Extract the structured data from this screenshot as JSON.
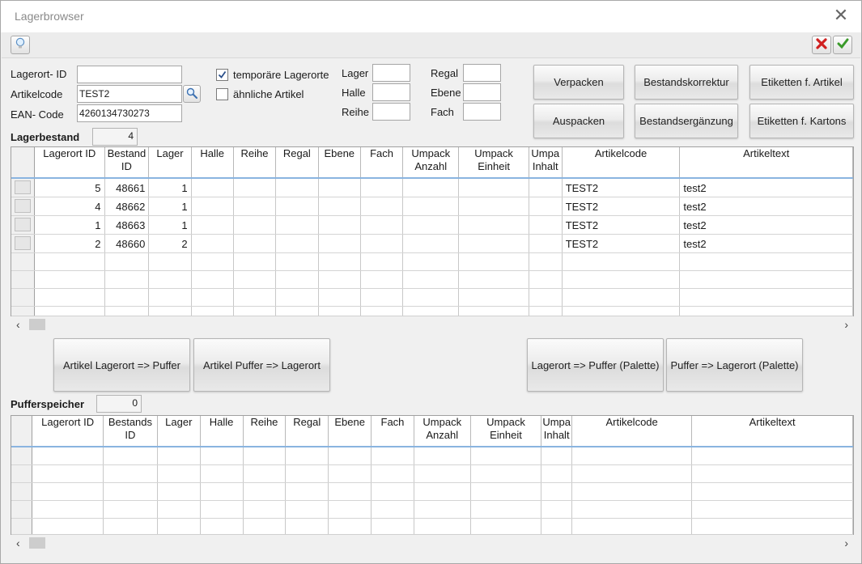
{
  "window": {
    "title": "Lagerbrowser"
  },
  "icons": {
    "hint": "lightbulb-icon",
    "cancel": "red-x-icon",
    "ok": "green-check-icon",
    "search": "magnifier-icon",
    "close": "close-icon"
  },
  "colors": {
    "header_underline": "#8ab4e0",
    "cancel_red": "#d02020",
    "ok_green": "#3a9a2a"
  },
  "filters": {
    "lagerort_id_label": "Lagerort- ID",
    "lagerort_id_value": "",
    "artikelcode_label": "Artikelcode",
    "artikelcode_value": "TEST2",
    "ean_label": "EAN- Code",
    "ean_value": "4260134730273",
    "temp_label": "temporäre Lagerorte",
    "temp_checked": true,
    "similar_label": "ähnliche Artikel",
    "similar_checked": false,
    "lager_label": "Lager",
    "halle_label": "Halle",
    "reihe_label": "Reihe",
    "regal_label": "Regal",
    "ebene_label": "Ebene",
    "fach_label": "Fach"
  },
  "actions": {
    "verpacken": "Verpacken",
    "auspacken": "Auspacken",
    "bestandskorrektur": "Bestandskorrektur",
    "bestandsergaenzung": "Bestandsergänzung",
    "etiketten_artikel": "Etiketten f. Artikel",
    "etiketten_kartons": "Etiketten f. Kartons"
  },
  "lagerbestand": {
    "label": "Lagerbestand",
    "count": "4",
    "columns": [
      "Lagerort ID",
      "Bestand ID",
      "Lager",
      "Halle",
      "Reihe",
      "Regal",
      "Ebene",
      "Fach",
      "Umpack Anzahl",
      "Umpack Einheit",
      "Umpa Inhalt",
      "Artikelcode",
      "Artikeltext"
    ],
    "rows": [
      [
        "5",
        "48661",
        "1",
        "",
        "",
        "",
        "",
        "",
        "",
        "",
        "",
        "TEST2",
        "test2"
      ],
      [
        "4",
        "48662",
        "1",
        "",
        "",
        "",
        "",
        "",
        "",
        "",
        "",
        "TEST2",
        "test2"
      ],
      [
        "1",
        "48663",
        "1",
        "",
        "",
        "",
        "",
        "",
        "",
        "",
        "",
        "TEST2",
        "test2"
      ],
      [
        "2",
        "48660",
        "2",
        "",
        "",
        "",
        "",
        "",
        "",
        "",
        "",
        "TEST2",
        "test2"
      ]
    ]
  },
  "transfer": {
    "artikel_to_puffer": "Artikel Lagerort => Puffer",
    "puffer_to_lagerort": "Artikel Puffer => Lagerort",
    "lagerort_to_puffer_palette": "Lagerort => Puffer (Palette)",
    "puffer_to_lagerort_palette": "Puffer => Lagerort (Palette)"
  },
  "pufferspeicher": {
    "label": "Pufferspeicher",
    "count": "0",
    "columns": [
      "Lagerort ID",
      "Bestands ID",
      "Lager",
      "Halle",
      "Reihe",
      "Regal",
      "Ebene",
      "Fach",
      "Umpack Anzahl",
      "Umpack Einheit",
      "Umpa Inhalt",
      "Artikelcode",
      "Artikeltext"
    ]
  }
}
